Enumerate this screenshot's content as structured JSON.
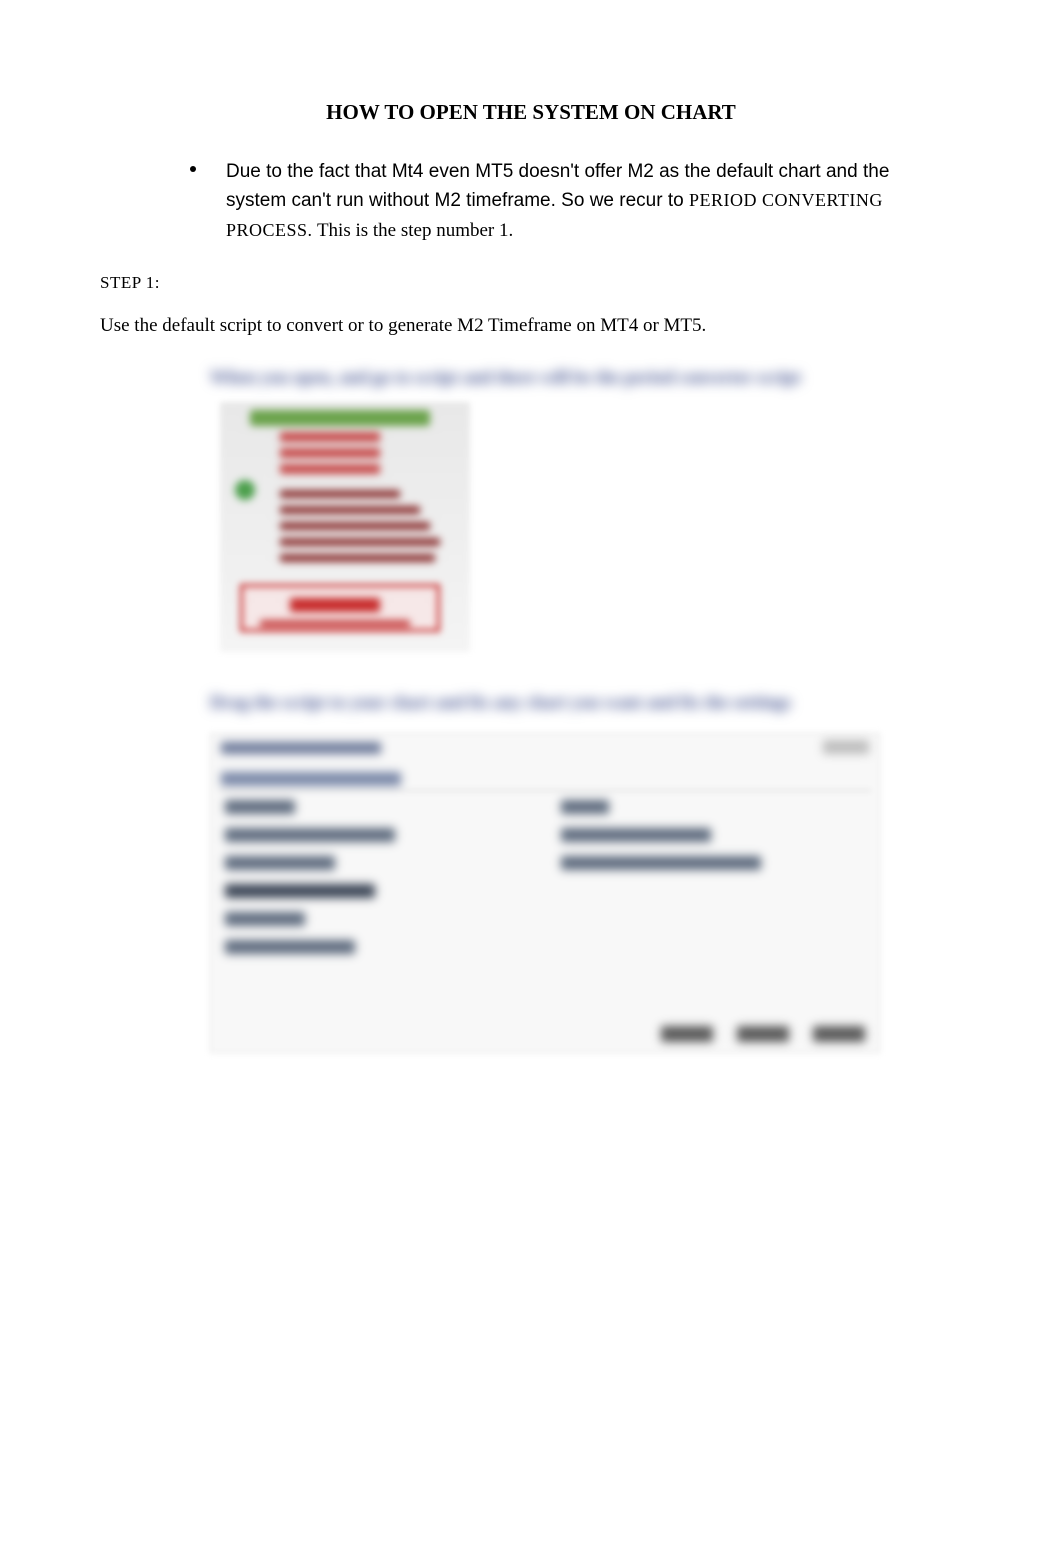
{
  "title": "HOW TO OPEN THE SYSTEM ON CHART",
  "bullet": {
    "part1": "Due to the fact that Mt4 even MT5 doesn't offer M2 as the default chart and the system can't run without M2 timeframe. So we recur to ",
    "small1": "PERIOD CONVERTING PROCESS.",
    "part2": "  This is the step number 1."
  },
  "step1_label": "STEP 1:",
  "step1_body": "Use the default script to convert or to generate M2 Timeframe on MT4 or MT5.",
  "blurred_caption_1": "When you open, and go to script and there will be the period converter script",
  "blurred_caption_2": "Drag the script to your chart and fix any chart you want and fix the settings"
}
